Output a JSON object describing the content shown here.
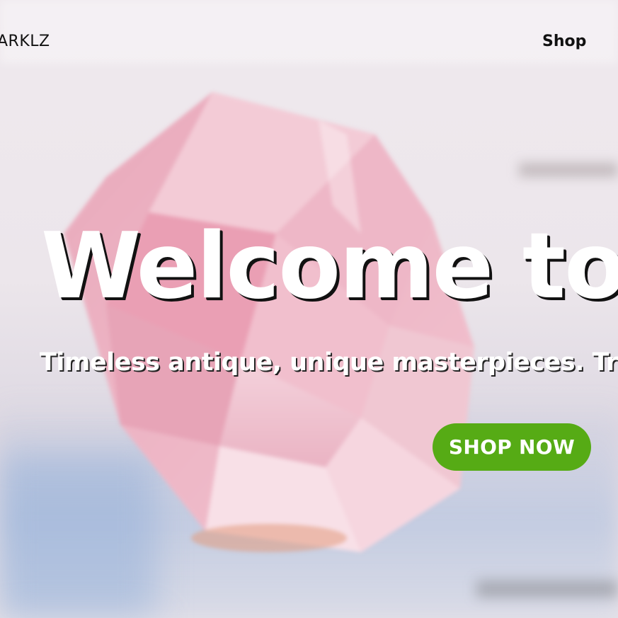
{
  "nav": {
    "brand": "ARKLZ",
    "shop_link": "Shop"
  },
  "hero": {
    "title": "Welcome to I",
    "subtitle": "Timeless antique, unique masterpieces. Try s",
    "cta_label": "SHOP NOW"
  },
  "colors": {
    "cta_background": "#56ab15",
    "title_text": "#ffffff",
    "nav_text": "#111111"
  },
  "background": {
    "image_subject": "blurred pink rose-quartz crystal on white wooden surface"
  }
}
